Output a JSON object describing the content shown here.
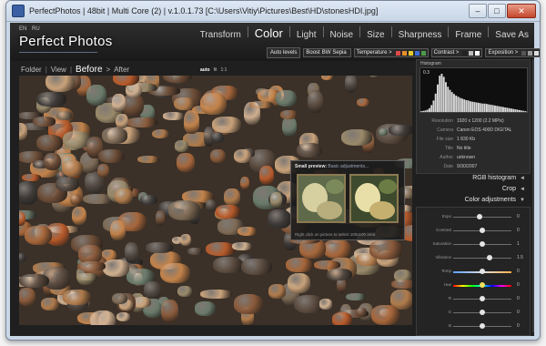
{
  "window": {
    "title": "PerfectPhotos | 48bit | Multi Core (2) | v.1.0.1.73 [C:\\Users\\Vitiy\\Pictures\\Best\\HD\\stonesHDI.jpg]",
    "minimize": "–",
    "maximize": "□",
    "close": "✕"
  },
  "header": {
    "languages": [
      "EN",
      "RU"
    ],
    "app_name": "Perfect Photos",
    "nav": [
      {
        "label": "Transform",
        "active": false
      },
      {
        "label": "Color",
        "active": true
      },
      {
        "label": "Light",
        "active": false
      },
      {
        "label": "Noise",
        "active": false
      },
      {
        "label": "Size",
        "active": false
      },
      {
        "label": "Sharpness",
        "active": false
      },
      {
        "label": "Frame",
        "active": false
      },
      {
        "label": "Save As",
        "active": false
      }
    ],
    "tools": {
      "auto_levels": "Auto levels",
      "boost": "Boost",
      "bw": "BW",
      "sepia": "Sepia",
      "temperature": "Temperature >",
      "temperature_colors": [
        "#e04a4a",
        "#e8902a",
        "#e6c830",
        "#3b6ed8",
        "#4a9a4a"
      ],
      "contrast": "Contrast >",
      "contrast_colors": [
        "#222222",
        "#bbbbbb",
        "#ffffff"
      ],
      "exposition": "Exposition >",
      "exposition_colors": [
        "#555555",
        "#999999",
        "#dddddd"
      ]
    }
  },
  "view_modes": {
    "folder": "Folder",
    "view": "View",
    "before": "Before",
    "sep": ">",
    "after": "After",
    "zoom": [
      {
        "label": "auto",
        "active": true
      },
      {
        "label": "fit",
        "active": false
      },
      {
        "label": "1:1",
        "active": false
      }
    ]
  },
  "small_preview": {
    "title": "Small preview:",
    "subtitle": "Basic adjustments...",
    "hint": "Right click on picture to select 100x100 area"
  },
  "info": {
    "histogram_title": "Histogram",
    "histogram_value": "0.3",
    "histogram_bins": [
      2,
      3,
      4,
      6,
      10,
      18,
      30,
      48,
      72,
      95,
      100,
      92,
      78,
      66,
      58,
      52,
      47,
      43,
      40,
      37,
      35,
      33,
      31,
      30,
      28,
      27,
      26,
      25,
      24,
      23,
      22,
      22,
      21,
      20,
      19,
      18,
      17,
      16,
      15,
      14,
      13,
      12,
      11,
      10,
      9,
      8,
      7,
      6,
      5,
      4,
      3,
      2
    ],
    "meta": [
      {
        "key": "Resolution",
        "value": "1920 x 1200 (2.2 MPix)"
      },
      {
        "key": "Camera",
        "value": "Canon EOS 400D DIGITAL"
      },
      {
        "key": "File size",
        "value": "1 830 Kb"
      },
      {
        "key": "Title",
        "value": "No title"
      },
      {
        "key": "Author",
        "value": "unknown"
      },
      {
        "key": "Date",
        "value": "9/30/2007"
      }
    ]
  },
  "sections": {
    "rgb_histogram": "RGB histogram",
    "crop": "Crop",
    "color_adjustments": "Color adjustments",
    "collapsed_arrow": "◄",
    "expanded_arrow": "▼"
  },
  "adjustments": [
    {
      "label": "Expo",
      "value": "0",
      "level": 0.45,
      "color": "#e4e4e4"
    },
    {
      "label": "Contrast",
      "value": "0",
      "level": 0.5,
      "color": "#e4e4e4"
    },
    {
      "label": "Saturation",
      "value": "1",
      "level": 0.5,
      "color": "#e4e4e4"
    },
    {
      "label": "Vibrance",
      "value": "1.5",
      "level": 0.62,
      "color": "#e4e4e4"
    },
    {
      "label": "Temp",
      "value": "0",
      "level": 0.5,
      "color": "#e4e4e4"
    },
    {
      "label": "Hue",
      "value": "0",
      "level": 0.5,
      "color": "#f0e060"
    },
    {
      "label": "R",
      "value": "0",
      "level": 0.5,
      "color": "#e4e4e4"
    },
    {
      "label": "G",
      "value": "0",
      "level": 0.5,
      "color": "#e4e4e4"
    },
    {
      "label": "B",
      "value": "0",
      "level": 0.5,
      "color": "#e4e4e4"
    }
  ]
}
